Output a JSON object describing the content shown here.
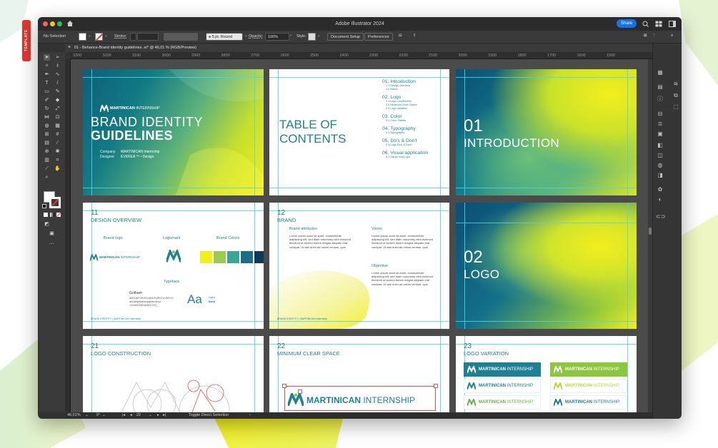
{
  "side_tab": "TEMPLATE",
  "app": {
    "title": "Adobe Illustrator 2024",
    "share": "Share"
  },
  "control": {
    "selection": "No Selection",
    "stroke": "Stroke:",
    "brush": "5 pt. Round",
    "opacity_label": "Opacity:",
    "opacity": "100%",
    "style": "Style:",
    "doc_setup": "Document Setup",
    "preferences": "Preferences"
  },
  "doc_tab": {
    "close": "×",
    "name": "01 - Behance-Brand identity guidelines .ai* @ 46,01 % (RGB/Preview)"
  },
  "ruler": [
    "3300",
    "3200",
    "3100",
    "3000",
    "2900",
    "2800",
    "2700",
    "2600",
    "2500",
    "2400",
    "2300",
    "2200",
    "2100",
    "2000",
    "1900",
    "1800",
    "1700",
    "1600",
    "1500"
  ],
  "status": {
    "zoom": "46,01%",
    "angle": "0°",
    "page": "22",
    "tool": "Toggle Direct Selection"
  },
  "colors": {
    "accent": "#1473e6",
    "teal": "#1f7f94",
    "navy": "#0e4a6b",
    "lime": "#e7f132",
    "yellow": "#f3ee1d"
  },
  "artboards": {
    "cover": {
      "brand": "MARTINICAN",
      "brand_suffix": "INTERNSHIP",
      "line1": "BRAND IDENTITY",
      "line2": "GUIDELINES",
      "company_label": "Company",
      "company": "MARTINICAN Internship",
      "designer_label": "Designer",
      "designer": "EVKREA ™ • Design"
    },
    "toc": {
      "title1": "TABLE OF",
      "title2": "CONTENTS",
      "sections": [
        {
          "h": "01. Introduction",
          "items": [
            "1.1  Design overview",
            "1.2  Brand"
          ]
        },
        {
          "h": "02. Logo",
          "items": [
            "2.1  Logo construction",
            "2.2  Minimum Clear Space",
            "2.3  Logo variation"
          ]
        },
        {
          "h": "03. Color",
          "items": [
            "3.1  Color Palette"
          ]
        },
        {
          "h": "04. Typography",
          "items": [
            "4.1  Typography"
          ]
        },
        {
          "h": "05. Do's & Don't",
          "items": [
            "5.1  Logo Do's & Don't"
          ]
        },
        {
          "h": "06. Visual application",
          "items": [
            "6.1  Visual mock-ups"
          ]
        }
      ]
    },
    "intro": {
      "num": "01",
      "title": "INTRODUCTION"
    },
    "design_overview": {
      "num": "11",
      "title": "DESIGN OVERVIEW",
      "brand_logo": "Brand logo",
      "logomark": "Logomark",
      "brand_colors": "Brand Colors",
      "typeface": "Typeface",
      "font": "Gotham",
      "alphabet": "ABCDEFGHIJKLMNOPQRSTUVWXYZ",
      "lower": "abcdefghijklmnopqrstuvwxyz",
      "digits": "1234567890!@#$%^&*()",
      "aa": "Aa",
      "light": "Light",
      "bold": "Bold",
      "footer": "BRAND IDENTITY  |  MARTINICAN Internship",
      "swatches": [
        "#f3ee1d",
        "#9ccc4f",
        "#3aa69a",
        "#1a6f86",
        "#0e3a57"
      ]
    },
    "brand": {
      "num": "12",
      "title": "BRAND",
      "attr": "Brand attributes",
      "vision": "Vision",
      "objective": "Objective",
      "lorem": "Lorem ipsum dolor sit amet, consectetuer adipiscing elit, sed diam nonummy nibh euismod tincidunt ut laoreet dolore magna aliquam erat volutpat. Ut wisi enim ad minim veniam, quis",
      "footer": "BRAND IDENTITY  |  MARTINICAN Internship"
    },
    "logo": {
      "num": "02",
      "title": "LOGO"
    },
    "construction": {
      "num": "21",
      "title": "LOGO CONSTRUCTION"
    },
    "clear_space": {
      "num": "22",
      "title": "MINIMUM CLEAR SPACE",
      "brand": "MARTINICAN",
      "suffix": "INTERNSHIP"
    },
    "variation": {
      "num": "23",
      "title": "LOGO VARIATION",
      "brand": "MARTINICAN",
      "suffix": "INTERNSHIP"
    }
  }
}
